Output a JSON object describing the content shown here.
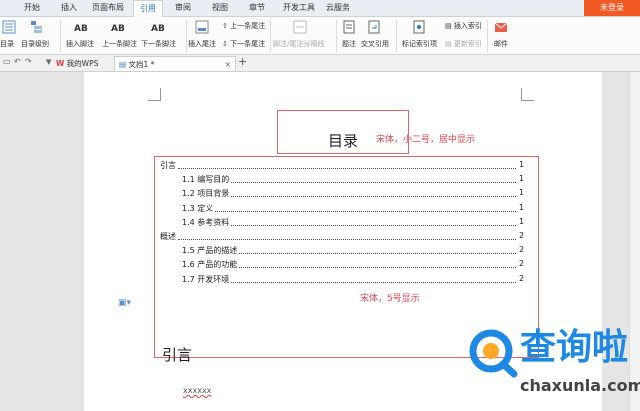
{
  "menubar": {
    "tabs": [
      "开始",
      "插入",
      "页面布局",
      "引用",
      "审阅",
      "视图",
      "章节",
      "开发工具",
      "云服务"
    ],
    "active_tab": "引用",
    "login": "未登录"
  },
  "ribbon": {
    "toc": "目录",
    "toc_level": "目录级别",
    "insert_footnote": "插入脚注",
    "prev_footnote": "上一条脚注",
    "next_footnote": "下一条脚注",
    "insert_endnote": "插入尾注",
    "prev_endnote": "上一条尾注",
    "next_endnote": "下一条尾注",
    "footnote_sep": "脚注/尾注分隔线",
    "caption": "题注",
    "cross_ref": "交叉引用",
    "mark_index": "标记索引项",
    "insert_index": "插入索引",
    "update_index": "更新索引",
    "mail": "邮件",
    "ab_label": "AB"
  },
  "tabbar": {
    "wps_tab": "我的WPS",
    "doc_tab": "文档1 *",
    "close": "×",
    "add": "+"
  },
  "document": {
    "title": "目录",
    "title_note": "宋体，小二号，居中显示",
    "toc_note": "宋体，5号显示",
    "toc_entries": [
      {
        "text": "引言",
        "page": "1",
        "indent": 0
      },
      {
        "text": "1.1 编写目的",
        "page": "1",
        "indent": 1
      },
      {
        "text": "1.2 项目背景",
        "page": "1",
        "indent": 1
      },
      {
        "text": "1.3 定义",
        "page": "1",
        "indent": 1
      },
      {
        "text": "1.4 参考资料",
        "page": "1",
        "indent": 1
      },
      {
        "text": "概述",
        "page": "2",
        "indent": 0
      },
      {
        "text": "1.5 产品的描述",
        "page": "2",
        "indent": 1
      },
      {
        "text": "1.6 产品的功能",
        "page": "2",
        "indent": 1
      },
      {
        "text": "1.7 开发环境",
        "page": "2",
        "indent": 1
      }
    ],
    "heading": "引言",
    "body_text": "xxxxxx"
  },
  "watermark": {
    "brand": "查询啦",
    "site": "chaxunla.com"
  },
  "colors": {
    "accent": "#2a7bc4",
    "login_bg": "#f15a24",
    "note_red": "#e0454d",
    "watermark_blue": "#1e88e5"
  }
}
